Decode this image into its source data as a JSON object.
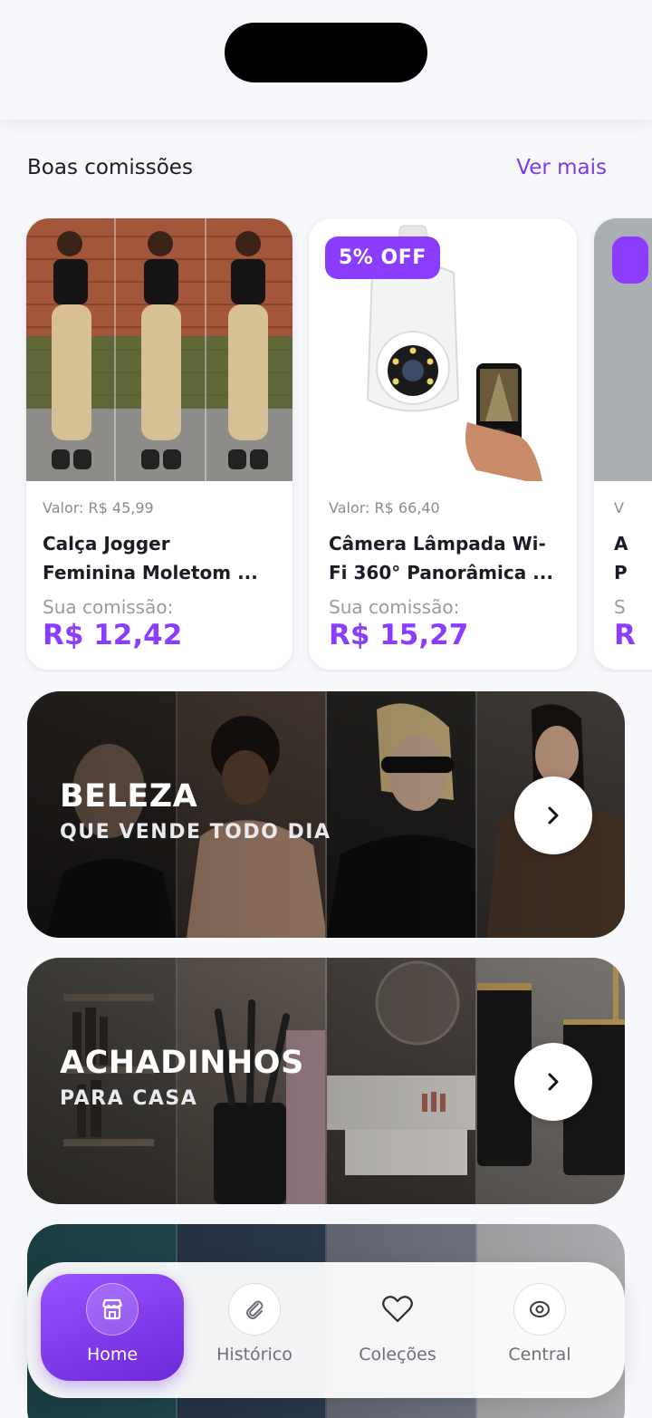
{
  "section": {
    "title": "Boas comissões",
    "see_more": "Ver mais"
  },
  "products": [
    {
      "price": "Valor: R$ 45,99",
      "name_line1": "Calça Jogger",
      "name_line2": "Feminina Moletom ...",
      "commission_label": "Sua comissão:",
      "commission_value": "R$ 12,42",
      "badge": ""
    },
    {
      "price": "Valor: R$ 66,40",
      "name_line1": "Câmera Lâmpada Wi-",
      "name_line2": "Fi 360° Panorâmica ...",
      "commission_label": "Sua comissão:",
      "commission_value": "R$ 15,27",
      "badge": "5% OFF"
    },
    {
      "price": "V",
      "name_line1": "A",
      "name_line2": "P",
      "commission_label": "S",
      "commission_value": "R"
    }
  ],
  "banners": [
    {
      "title": "BELEZA",
      "subtitle": "QUE VENDE TODO DIA"
    },
    {
      "title": "ACHADINHOS",
      "subtitle": "PARA CASA"
    }
  ],
  "nav": [
    {
      "label": "Home",
      "icon": "store-icon"
    },
    {
      "label": "Histórico",
      "icon": "paperclip-icon"
    },
    {
      "label": "Coleções",
      "icon": "heart-icon"
    },
    {
      "label": "Central",
      "icon": "eye-icon"
    }
  ],
  "colors": {
    "accent": "#8b3dff",
    "background": "#f7f8fb"
  }
}
